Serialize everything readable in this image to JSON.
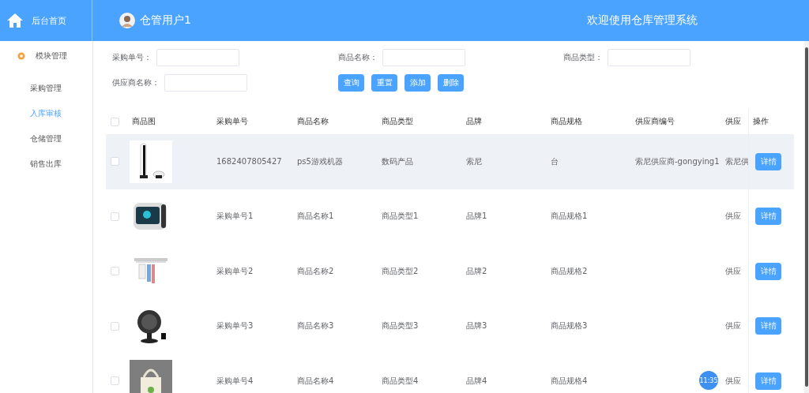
{
  "sidebar": {
    "home": "后台首页",
    "group": "模块管理",
    "items": [
      {
        "label": "采购管理",
        "selected": false
      },
      {
        "label": "入库审核",
        "selected": true
      },
      {
        "label": "仓储管理",
        "selected": false
      },
      {
        "label": "销售出库",
        "selected": false
      }
    ]
  },
  "header": {
    "user": "仓管用户1",
    "title": "欢迎使用仓库管理系统"
  },
  "filters": [
    {
      "label": "采购单号："
    },
    {
      "label": "商品名称："
    },
    {
      "label": "商品类型："
    },
    {
      "label": "供应商名称："
    }
  ],
  "buttons": [
    "查询",
    "重置",
    "添加",
    "删除"
  ],
  "table": {
    "columns": [
      "商品图",
      "采购单号",
      "商品名称",
      "商品类型",
      "品牌",
      "商品规格",
      "供应商编号",
      "供应",
      "操作"
    ],
    "header_checked": false,
    "rows": [
      {
        "checked": false,
        "highlighted": true,
        "cells": [
          "",
          "1682407805427",
          "ps5游戏机器",
          "数码产品",
          "索尼",
          "台",
          "索尼供应商-gongying1",
          "索尼供"
        ],
        "action": "详情"
      },
      {
        "checked": false,
        "highlighted": false,
        "cells": [
          "",
          "采购单号1",
          "商品名称1",
          "商品类型1",
          "品牌1",
          "商品规格1",
          "",
          "供应"
        ],
        "action": "详情"
      },
      {
        "checked": false,
        "highlighted": false,
        "cells": [
          "",
          "采购单号2",
          "商品名称2",
          "商品类型2",
          "品牌2",
          "商品规格2",
          "",
          "供应"
        ],
        "action": "详情"
      },
      {
        "checked": false,
        "highlighted": false,
        "cells": [
          "",
          "采购单号3",
          "商品名称3",
          "商品类型3",
          "品牌3",
          "商品规格3",
          "",
          "供应"
        ],
        "action": "详情"
      },
      {
        "checked": false,
        "highlighted": false,
        "cells": [
          "",
          "采购单号4",
          "商品名称4",
          "商品类型4",
          "品牌4",
          "商品规格4",
          "",
          "供应"
        ],
        "action": "详情"
      }
    ]
  },
  "clock": "11:35"
}
